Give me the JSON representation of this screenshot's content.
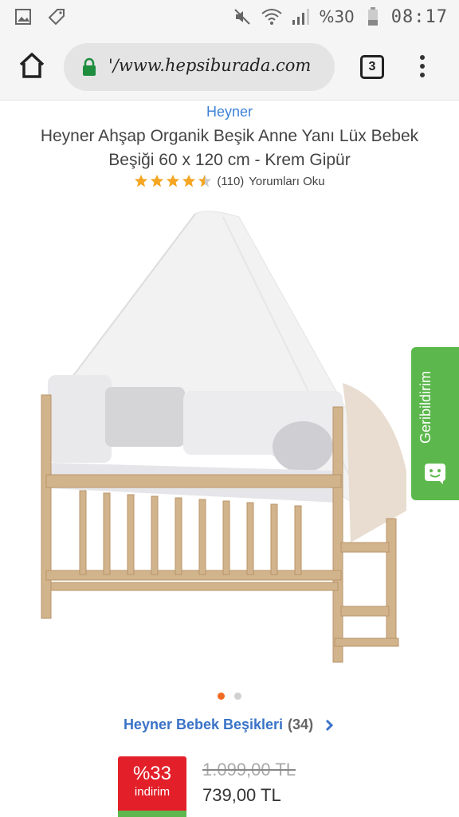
{
  "status_bar": {
    "battery_text": "%30",
    "clock": "08:17",
    "icons": [
      "gallery-icon",
      "tag-icon",
      "mute-icon",
      "wifi-icon",
      "signal-icon",
      "battery-icon"
    ]
  },
  "browser": {
    "url": "'/www.hepsiburada.com",
    "tab_count": "3",
    "icons": [
      "home-icon",
      "lock-icon",
      "more-vert-icon"
    ]
  },
  "product": {
    "brand": "Heyner",
    "title": "Heyner Ahşap Organik Beşik Anne Yanı Lüx Bebek Beşiği 60 x 120 cm - Krem Gipür",
    "rating": 4.5,
    "review_count": "(110)",
    "review_link": "Yorumları Oku"
  },
  "feedback": {
    "label": "Geribildirim",
    "color": "#5cb84d"
  },
  "carousel": {
    "active_index": 0,
    "count": 2
  },
  "category": {
    "label": "Heyner Bebek Beşikleri",
    "count": "(34)"
  },
  "pricing": {
    "discount": "%33",
    "discount_label": "indirim",
    "old_price": "1.099,00 TL",
    "new_price": "739,00 TL"
  },
  "colors": {
    "brand_blue": "#3f82d8",
    "discount_red": "#e3202a",
    "accent_orange": "#f26b22",
    "star_gold": "#f5a623"
  }
}
